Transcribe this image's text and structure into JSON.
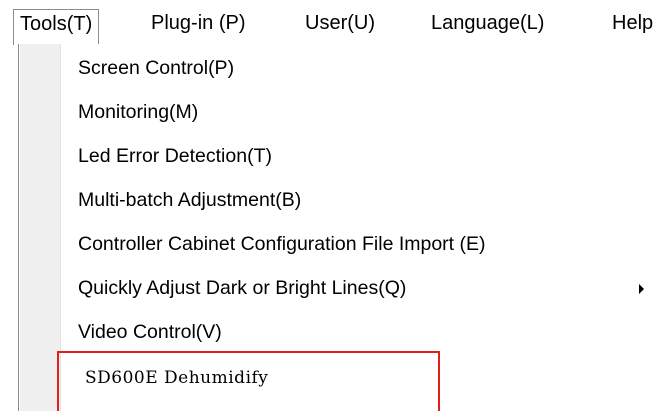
{
  "menubar": {
    "tabs": [
      {
        "label": "Tools(T)"
      },
      {
        "label": "Plug-in (P)"
      },
      {
        "label": "User(U)"
      },
      {
        "label": "Language(L)"
      },
      {
        "label": "Help"
      }
    ]
  },
  "dropdown": {
    "items": [
      {
        "label": "Screen Control(P)"
      },
      {
        "label": "Monitoring(M)"
      },
      {
        "label": "Led Error Detection(T)"
      },
      {
        "label": "Multi-batch Adjustment(B)"
      },
      {
        "label": "Controller Cabinet Configuration File Import (E)"
      },
      {
        "label": "Quickly Adjust Dark or Bright Lines(Q)",
        "has_submenu": true
      },
      {
        "label": "Video Control(V)"
      },
      {
        "label": "SD600E Dehumidify"
      }
    ]
  },
  "colors": {
    "highlight_border": "#e0201d",
    "icon_strip": "#f0f0f0",
    "menu_border": "#8c8c8c"
  }
}
